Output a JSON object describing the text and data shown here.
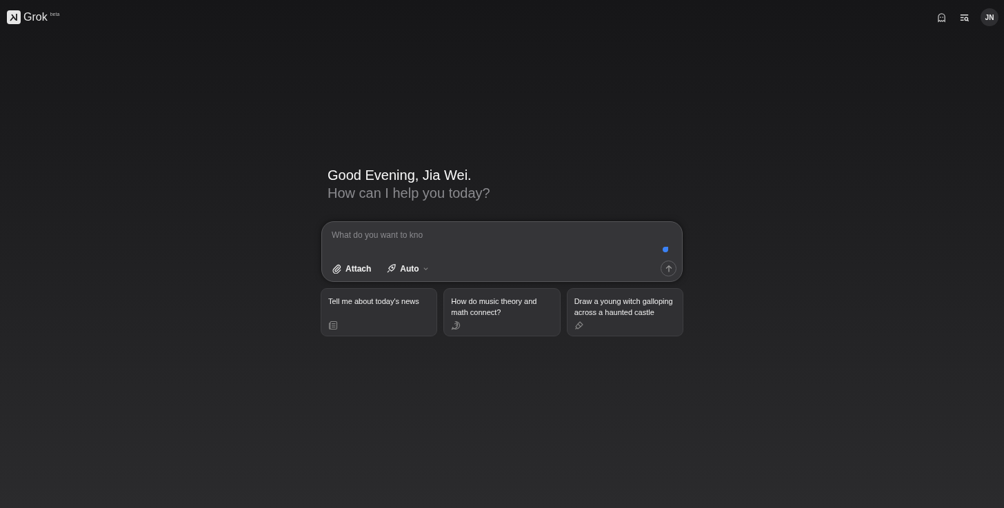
{
  "header": {
    "logo_text": "Grok",
    "badge": "beta",
    "avatar_initials": "JN"
  },
  "greeting": {
    "title": "Good Evening, Jia Wei.",
    "subtitle": "How can I help you today?"
  },
  "composer": {
    "placeholder": "What do you want to kno",
    "attach_label": "Attach",
    "mode_label": "Auto"
  },
  "suggestions": [
    {
      "text": "Tell me about today's news",
      "kind": "news"
    },
    {
      "text": "How do music theory and math connect?",
      "kind": "question"
    },
    {
      "text": "Draw a young witch galloping across a haunted castle",
      "kind": "brush"
    }
  ]
}
